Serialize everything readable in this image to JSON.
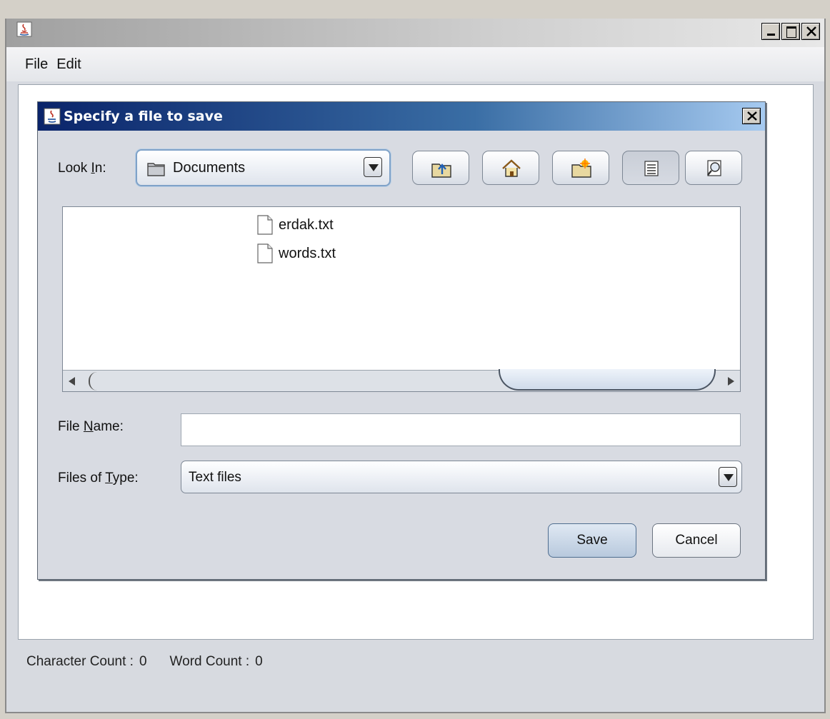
{
  "app": {
    "menu": [
      "File",
      "Edit"
    ],
    "status": {
      "char_label": "Character Count :",
      "char_value": "0",
      "word_label": "Word Count :",
      "word_value": "0"
    }
  },
  "dialog": {
    "title": "Specify a file to save",
    "look_in_label_pre": "Look ",
    "look_in_label_mnemonic": "I",
    "look_in_label_post": "n:",
    "look_in_value": "Documents",
    "toolbar": [
      "up-folder-icon",
      "home-icon",
      "new-folder-icon",
      "list-view-icon",
      "details-view-icon"
    ],
    "files": [
      "erdak.txt",
      "words.txt"
    ],
    "file_name_label_pre": "File ",
    "file_name_label_mnemonic": "N",
    "file_name_label_post": "ame:",
    "file_name_value": "",
    "file_type_label_pre": "Files of ",
    "file_type_label_mnemonic": "T",
    "file_type_label_post": "ype:",
    "file_type_value": "Text files",
    "save_label": "Save",
    "cancel_label": "Cancel"
  }
}
